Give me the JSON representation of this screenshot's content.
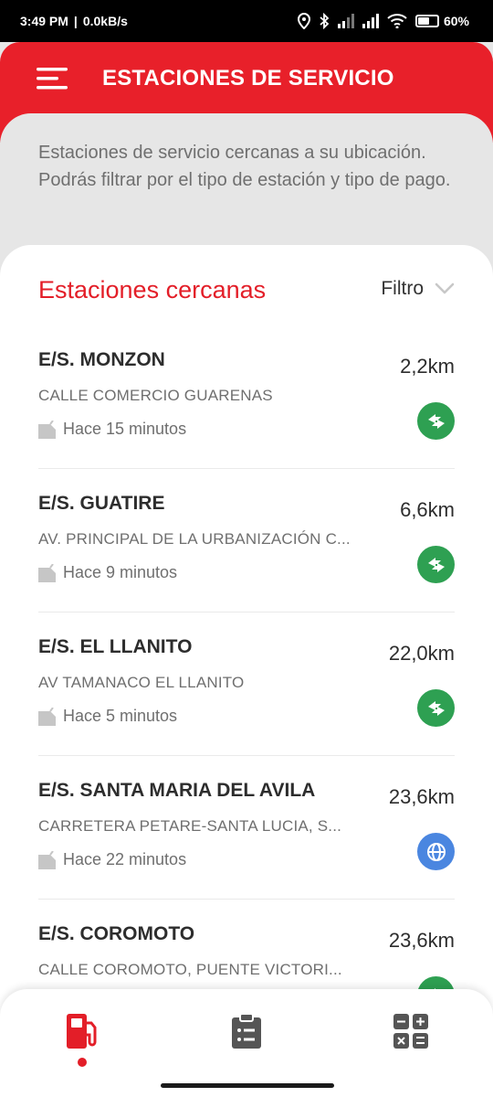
{
  "status_bar": {
    "time": "3:49 PM",
    "separator": "|",
    "network_speed": "0.0kB/s",
    "battery_label": "60",
    "battery_percent_sign": "%",
    "battery_level": 0.6
  },
  "header": {
    "title": "ESTACIONES DE SERVICIO"
  },
  "intro": {
    "text": "Estaciones de servicio cercanas a su ubicación. Podrás filtrar por el tipo de estación y tipo de pago."
  },
  "list_header": {
    "title": "Estaciones cercanas",
    "filter_label": "Filtro"
  },
  "stations": [
    {
      "name": "E/S. MONZON",
      "address": "CALLE COMERCIO GUARENAS",
      "updated": "Hace 15 minutos",
      "distance": "2,2km",
      "payment_icon": "transfer-icon"
    },
    {
      "name": "E/S. GUATIRE",
      "address": "AV. PRINCIPAL DE LA URBANIZACIÓN C...",
      "updated": "Hace 9 minutos",
      "distance": "6,6km",
      "payment_icon": "transfer-icon"
    },
    {
      "name": "E/S. EL LLANITO",
      "address": "AV TAMANACO EL LLANITO",
      "updated": "Hace 5 minutos",
      "distance": "22,0km",
      "payment_icon": "transfer-icon"
    },
    {
      "name": "E/S. SANTA MARIA DEL AVILA",
      "address": "CARRETERA PETARE-SANTA LUCIA, S...",
      "updated": "Hace 22 minutos",
      "distance": "23,6km",
      "payment_icon": "globe-icon"
    },
    {
      "name": "E/S. COROMOTO",
      "address": "CALLE COROMOTO, PUENTE VICTORI...",
      "updated": "",
      "distance": "23,6km",
      "payment_icon": "transfer-icon"
    }
  ],
  "colors": {
    "brand_red": "#e8202a",
    "title_red": "#e31e28",
    "transfer_green": "#2ea052",
    "globe_blue": "#4a86e0",
    "nav_gray": "#555555"
  },
  "bottom_nav": {
    "items": [
      "fuel-pump-icon",
      "clipboard-list-icon",
      "calculator-icon"
    ],
    "active": "fuel-pump-icon"
  }
}
